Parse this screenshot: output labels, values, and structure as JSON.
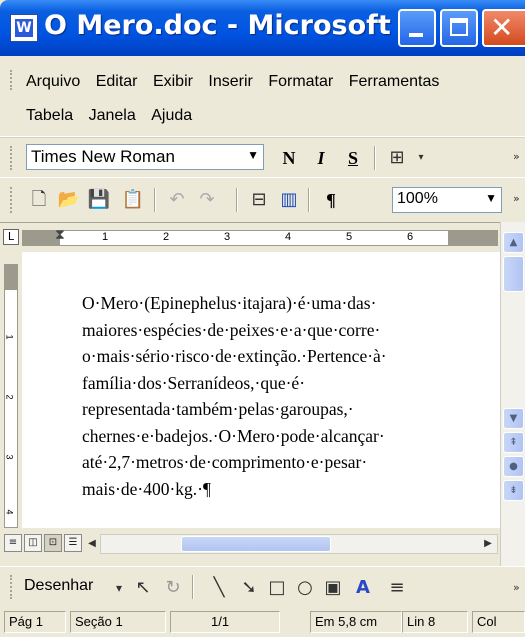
{
  "window": {
    "title": "O Mero.doc - Microsoft ...",
    "app_icon": "word-doc-icon",
    "title_color": "#0054e3"
  },
  "menu": {
    "row1": [
      "Arquivo",
      "Editar",
      "Exibir",
      "Inserir",
      "Formatar",
      "Ferramentas"
    ],
    "row2": [
      "Tabela",
      "Janela",
      "Ajuda"
    ]
  },
  "formatting_toolbar": {
    "font_name": "Times New Roman",
    "bold": "N",
    "italic": "I",
    "underline": "S"
  },
  "standard_toolbar": {
    "pilcrow": "¶",
    "zoom": "100%"
  },
  "ruler": {
    "ticks": [
      "1",
      "2",
      "3",
      "4",
      "5",
      "6"
    ]
  },
  "vertical_ruler": {
    "ticks": [
      "1",
      "2",
      "3",
      "4"
    ]
  },
  "document": {
    "lines": [
      "O·Mero·(Epinephelus·itajara)·é·uma·das·",
      "maiores·espécies·de·peixes·e·a·que·corre·",
      "o·mais·sério·risco·de·extinção.·Pertence·à·",
      "família·dos·Serranídeos,·que·é·",
      "representada·também·pelas·garoupas,·",
      "chernes·e·badejos.·O·Mero·pode·alcançar·",
      "até·2,7·metros·de·comprimento·e·pesar·",
      "mais·de·400·kg.·¶"
    ]
  },
  "drawing_toolbar": {
    "label": "Desenhar"
  },
  "status": {
    "page": "Pág 1",
    "section": "Seção 1",
    "pages": "1/1",
    "position": "Em 5,8 cm",
    "line": "Lin 8",
    "column": "Col"
  }
}
